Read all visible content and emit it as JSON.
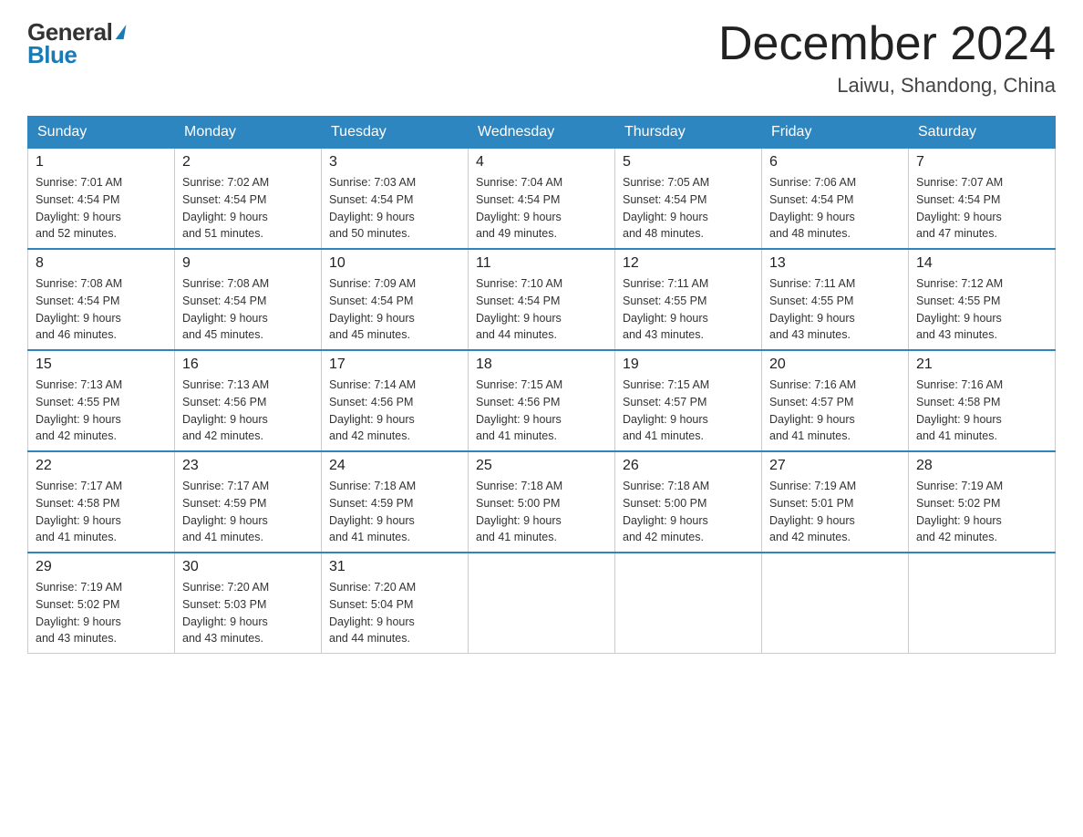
{
  "logo": {
    "general": "General",
    "blue": "Blue",
    "triangle_symbol": "▶"
  },
  "header": {
    "title": "December 2024",
    "location": "Laiwu, Shandong, China"
  },
  "days_of_week": [
    "Sunday",
    "Monday",
    "Tuesday",
    "Wednesday",
    "Thursday",
    "Friday",
    "Saturday"
  ],
  "weeks": [
    [
      {
        "day": "1",
        "sunrise": "7:01 AM",
        "sunset": "4:54 PM",
        "daylight": "9 hours and 52 minutes."
      },
      {
        "day": "2",
        "sunrise": "7:02 AM",
        "sunset": "4:54 PM",
        "daylight": "9 hours and 51 minutes."
      },
      {
        "day": "3",
        "sunrise": "7:03 AM",
        "sunset": "4:54 PM",
        "daylight": "9 hours and 50 minutes."
      },
      {
        "day": "4",
        "sunrise": "7:04 AM",
        "sunset": "4:54 PM",
        "daylight": "9 hours and 49 minutes."
      },
      {
        "day": "5",
        "sunrise": "7:05 AM",
        "sunset": "4:54 PM",
        "daylight": "9 hours and 48 minutes."
      },
      {
        "day": "6",
        "sunrise": "7:06 AM",
        "sunset": "4:54 PM",
        "daylight": "9 hours and 48 minutes."
      },
      {
        "day": "7",
        "sunrise": "7:07 AM",
        "sunset": "4:54 PM",
        "daylight": "9 hours and 47 minutes."
      }
    ],
    [
      {
        "day": "8",
        "sunrise": "7:08 AM",
        "sunset": "4:54 PM",
        "daylight": "9 hours and 46 minutes."
      },
      {
        "day": "9",
        "sunrise": "7:08 AM",
        "sunset": "4:54 PM",
        "daylight": "9 hours and 45 minutes."
      },
      {
        "day": "10",
        "sunrise": "7:09 AM",
        "sunset": "4:54 PM",
        "daylight": "9 hours and 45 minutes."
      },
      {
        "day": "11",
        "sunrise": "7:10 AM",
        "sunset": "4:54 PM",
        "daylight": "9 hours and 44 minutes."
      },
      {
        "day": "12",
        "sunrise": "7:11 AM",
        "sunset": "4:55 PM",
        "daylight": "9 hours and 43 minutes."
      },
      {
        "day": "13",
        "sunrise": "7:11 AM",
        "sunset": "4:55 PM",
        "daylight": "9 hours and 43 minutes."
      },
      {
        "day": "14",
        "sunrise": "7:12 AM",
        "sunset": "4:55 PM",
        "daylight": "9 hours and 43 minutes."
      }
    ],
    [
      {
        "day": "15",
        "sunrise": "7:13 AM",
        "sunset": "4:55 PM",
        "daylight": "9 hours and 42 minutes."
      },
      {
        "day": "16",
        "sunrise": "7:13 AM",
        "sunset": "4:56 PM",
        "daylight": "9 hours and 42 minutes."
      },
      {
        "day": "17",
        "sunrise": "7:14 AM",
        "sunset": "4:56 PM",
        "daylight": "9 hours and 42 minutes."
      },
      {
        "day": "18",
        "sunrise": "7:15 AM",
        "sunset": "4:56 PM",
        "daylight": "9 hours and 41 minutes."
      },
      {
        "day": "19",
        "sunrise": "7:15 AM",
        "sunset": "4:57 PM",
        "daylight": "9 hours and 41 minutes."
      },
      {
        "day": "20",
        "sunrise": "7:16 AM",
        "sunset": "4:57 PM",
        "daylight": "9 hours and 41 minutes."
      },
      {
        "day": "21",
        "sunrise": "7:16 AM",
        "sunset": "4:58 PM",
        "daylight": "9 hours and 41 minutes."
      }
    ],
    [
      {
        "day": "22",
        "sunrise": "7:17 AM",
        "sunset": "4:58 PM",
        "daylight": "9 hours and 41 minutes."
      },
      {
        "day": "23",
        "sunrise": "7:17 AM",
        "sunset": "4:59 PM",
        "daylight": "9 hours and 41 minutes."
      },
      {
        "day": "24",
        "sunrise": "7:18 AM",
        "sunset": "4:59 PM",
        "daylight": "9 hours and 41 minutes."
      },
      {
        "day": "25",
        "sunrise": "7:18 AM",
        "sunset": "5:00 PM",
        "daylight": "9 hours and 41 minutes."
      },
      {
        "day": "26",
        "sunrise": "7:18 AM",
        "sunset": "5:00 PM",
        "daylight": "9 hours and 42 minutes."
      },
      {
        "day": "27",
        "sunrise": "7:19 AM",
        "sunset": "5:01 PM",
        "daylight": "9 hours and 42 minutes."
      },
      {
        "day": "28",
        "sunrise": "7:19 AM",
        "sunset": "5:02 PM",
        "daylight": "9 hours and 42 minutes."
      }
    ],
    [
      {
        "day": "29",
        "sunrise": "7:19 AM",
        "sunset": "5:02 PM",
        "daylight": "9 hours and 43 minutes."
      },
      {
        "day": "30",
        "sunrise": "7:20 AM",
        "sunset": "5:03 PM",
        "daylight": "9 hours and 43 minutes."
      },
      {
        "day": "31",
        "sunrise": "7:20 AM",
        "sunset": "5:04 PM",
        "daylight": "9 hours and 44 minutes."
      },
      null,
      null,
      null,
      null
    ]
  ],
  "labels": {
    "sunrise": "Sunrise:",
    "sunset": "Sunset:",
    "daylight": "Daylight:"
  }
}
